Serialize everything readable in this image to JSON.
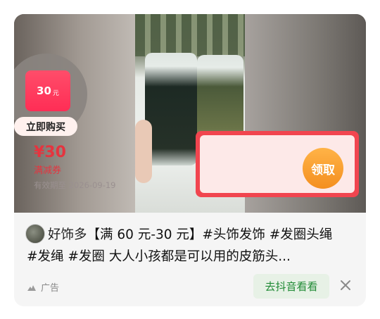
{
  "media": {
    "mini_coupon": {
      "amount": "30",
      "unit": "元"
    },
    "buy_now": "立即购买",
    "coupon": {
      "price": "¥30",
      "type": "满减券",
      "expiry": "有效期至 2026-09-19",
      "claim": "领取"
    }
  },
  "post": {
    "author": "好饰多",
    "title_rest": "【满 60 元-30 元】#头饰发饰 #发圈头绳",
    "title_line2": "#发绳 #发圈 大人小孩都是可以用的皮筋头...",
    "ad_label": "广告",
    "cta": "去抖音看看"
  },
  "colors": {
    "accent_red": "#f1454f",
    "claim_orange": "#f48f1f",
    "cta_green": "#1f8a34",
    "pink": "#ff2d55"
  },
  "icons": [
    "ad-icon",
    "close-icon"
  ]
}
